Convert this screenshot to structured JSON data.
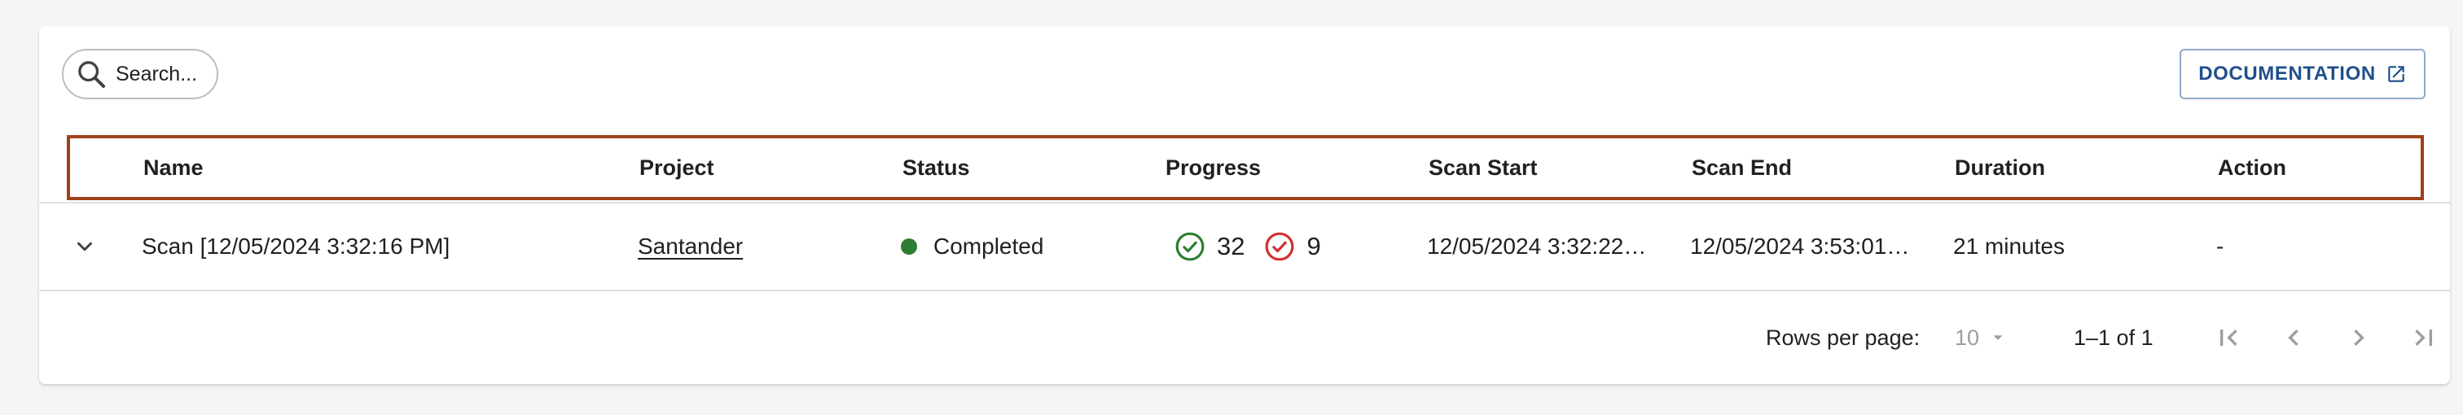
{
  "search": {
    "placeholder": "Search..."
  },
  "documentation_label": "DOCUMENTATION",
  "table": {
    "headers": [
      "Name",
      "Project",
      "Status",
      "Progress",
      "Scan Start",
      "Scan End",
      "Duration",
      "Action"
    ],
    "rows": [
      {
        "name": "Scan [12/05/2024 3:32:16 PM]",
        "project": "Santander",
        "status": "Completed",
        "status_color": "#2e7d32",
        "passed_count": "32",
        "failed_count": "9",
        "scan_start": "12/05/2024 3:32:22…",
        "scan_end": "12/05/2024 3:53:01…",
        "duration": "21 minutes",
        "action": "-"
      }
    ]
  },
  "pagination": {
    "rows_per_page_label": "Rows per page:",
    "rows_per_page_value": "10",
    "range_text": "1–1 of 1"
  },
  "colors": {
    "accent": "#1f4f8c",
    "highlight_border": "#a0401a",
    "passed": "#2e7d32",
    "failed": "#d32f2f"
  }
}
